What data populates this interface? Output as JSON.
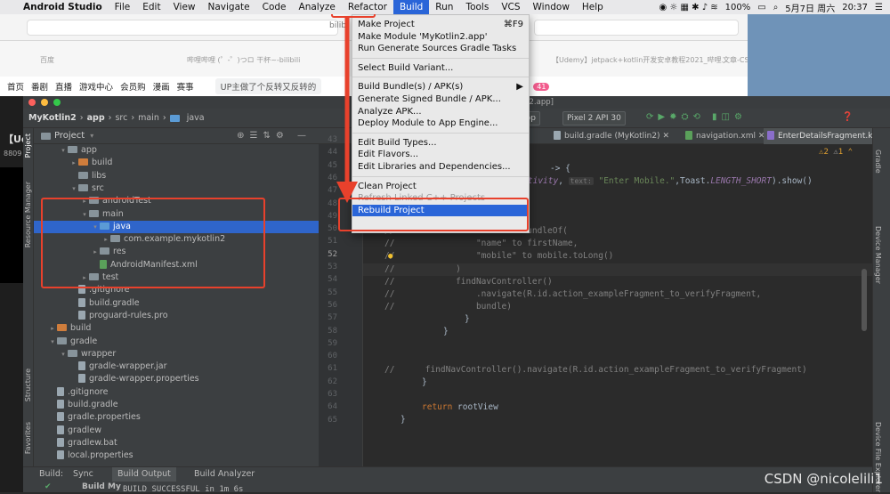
{
  "menubar": {
    "app": "Android Studio",
    "items": [
      "File",
      "Edit",
      "View",
      "Navigate",
      "Code",
      "Analyze",
      "Refactor",
      "Build",
      "Run",
      "Tools",
      "VCS",
      "Window",
      "Help"
    ],
    "battery": "100%",
    "date": "5月7日 周六",
    "time": "20:37"
  },
  "browser": {
    "tab1": "百度",
    "tab2": "哔哩哔哩 (゜-゜)つロ 干杯~-bilibili",
    "addr_frag": "bilib",
    "tab3": "【Udemy】jetpack+kotlin开发安卓教程2021_哔哩...",
    "tab4": "文章-CSDN创作中心",
    "nav": [
      "首页",
      "番剧",
      "直播",
      "游戏中心",
      "会员购",
      "漫画",
      "赛事"
    ],
    "notice": "UP主做了个反转又反转的",
    "badge": "41",
    "left_frag1": "【Ud",
    "left_frag2": "8809"
  },
  "ide": {
    "window_title": "…2.app]",
    "project": "MyKotlin2",
    "breadcrumb": [
      "app",
      "src",
      "main",
      "java"
    ],
    "device": "Pixel 2 API 30",
    "run_config": "app"
  },
  "project_pane": {
    "title": "Project",
    "rows": [
      {
        "label": "app",
        "indent": 2,
        "arrow": "▾",
        "kind": "folder-gray"
      },
      {
        "label": "build",
        "indent": 3,
        "arrow": "▸",
        "kind": "folder-orange"
      },
      {
        "label": "libs",
        "indent": 3,
        "arrow": "",
        "kind": "folder-gray"
      },
      {
        "label": "src",
        "indent": 3,
        "arrow": "▾",
        "kind": "folder-gray"
      },
      {
        "label": "androidTest",
        "indent": 4,
        "arrow": "▸",
        "kind": "folder-gray"
      },
      {
        "label": "main",
        "indent": 4,
        "arrow": "▾",
        "kind": "folder-gray"
      },
      {
        "label": "java",
        "indent": 5,
        "arrow": "▾",
        "kind": "folder-blue",
        "sel": true
      },
      {
        "label": "com.example.mykotlin2",
        "indent": 6,
        "arrow": "▸",
        "kind": "folder-gray"
      },
      {
        "label": "res",
        "indent": 5,
        "arrow": "▸",
        "kind": "folder-gray"
      },
      {
        "label": "AndroidManifest.xml",
        "indent": 5,
        "arrow": "",
        "kind": "file-xml"
      },
      {
        "label": "test",
        "indent": 4,
        "arrow": "▸",
        "kind": "folder-gray"
      },
      {
        "label": ".gitignore",
        "indent": 3,
        "arrow": "",
        "kind": "file"
      },
      {
        "label": "build.gradle",
        "indent": 3,
        "arrow": "",
        "kind": "file"
      },
      {
        "label": "proguard-rules.pro",
        "indent": 3,
        "arrow": "",
        "kind": "file"
      },
      {
        "label": "build",
        "indent": 1,
        "arrow": "▸",
        "kind": "folder-orange"
      },
      {
        "label": "gradle",
        "indent": 1,
        "arrow": "▾",
        "kind": "folder-gray"
      },
      {
        "label": "wrapper",
        "indent": 2,
        "arrow": "▾",
        "kind": "folder-gray"
      },
      {
        "label": "gradle-wrapper.jar",
        "indent": 3,
        "arrow": "",
        "kind": "file"
      },
      {
        "label": "gradle-wrapper.properties",
        "indent": 3,
        "arrow": "",
        "kind": "file"
      },
      {
        "label": ".gitignore",
        "indent": 1,
        "arrow": "",
        "kind": "file"
      },
      {
        "label": "build.gradle",
        "indent": 1,
        "arrow": "",
        "kind": "file"
      },
      {
        "label": "gradle.properties",
        "indent": 1,
        "arrow": "",
        "kind": "file"
      },
      {
        "label": "gradlew",
        "indent": 1,
        "arrow": "",
        "kind": "file"
      },
      {
        "label": "gradlew.bat",
        "indent": 1,
        "arrow": "",
        "kind": "file"
      },
      {
        "label": "local.properties",
        "indent": 1,
        "arrow": "",
        "kind": "file"
      }
    ]
  },
  "editor_tabs": [
    "build.gradle (MyKotlin2)",
    "navigation.xml",
    "EnterDetailsFragment.kt"
  ],
  "inspections": {
    "warnings": "2",
    "weak": "1"
  },
  "line_numbers": [
    "43",
    "44",
    "45",
    "46",
    "47",
    "48",
    "49",
    "50",
    "51",
    "52",
    "53",
    "54",
    "55",
    "56",
    "57",
    "58",
    "59",
    "60",
    "61",
    "62",
    "63",
    "64",
    "65"
  ],
  "code": {
    "l44a": "-> {",
    "l45a": "t(",
    "l45b": "activity",
    "l45c": ", ",
    "l45d": "text:",
    "l45e": " \"Enter Mobile.\"",
    "l45f": ",Toast.",
    "l45g": "LENGTH_SHORT",
    "l45h": ").show()",
    "l48a": "else",
    "l48b": " -> {",
    "l49": "//            val bundle = bundleOf(",
    "l50": "//                \"name\" to firstName,",
    "l51": "//                \"mobile\" to mobile.toLong()",
    "l52": "//            )",
    "l53": "//            findNavController()",
    "l54": "//                .navigate(R.id.action_exampleFragment_to_verifyFragment,",
    "l55": "//                bundle)",
    "l56": "}",
    "l57": "}",
    "l60": "//      findNavController().navigate(R.id.action_exampleFragment_to_verifyFragment)",
    "l61": "}",
    "l63a": "return",
    "l63b": " rootView",
    "l64": "}"
  },
  "build_menu": {
    "items": [
      {
        "label": "Make Project",
        "shortcut": "⌘F9"
      },
      {
        "label": "Make Module 'MyKotlin2.app'"
      },
      {
        "label": "Run Generate Sources Gradle Tasks"
      },
      {
        "sep": true
      },
      {
        "label": "Select Build Variant..."
      },
      {
        "sep": true
      },
      {
        "label": "Build Bundle(s) / APK(s)",
        "submenu": "▶"
      },
      {
        "label": "Generate Signed Bundle / APK..."
      },
      {
        "label": "Analyze APK..."
      },
      {
        "label": "Deploy Module to App Engine..."
      },
      {
        "sep": true
      },
      {
        "label": "Edit Build Types..."
      },
      {
        "label": "Edit Flavors..."
      },
      {
        "label": "Edit Libraries and Dependencies..."
      },
      {
        "sep": true
      },
      {
        "label": "Clean Project"
      },
      {
        "label": "Refresh Linked C++ Projects",
        "disabled": true
      },
      {
        "label": "Rebuild Project",
        "highlight": true
      }
    ]
  },
  "bottom": {
    "label": "Build:",
    "tabs": [
      "Sync",
      "Build Output",
      "Build Analyzer"
    ],
    "tree": "Build My",
    "status": "BUILD SUCCESSFUL in 1m 6s"
  },
  "side_tools": {
    "left": [
      "Project",
      "Resource Manager",
      "Structure",
      "Favorites"
    ],
    "right": [
      "Gradle",
      "Device Manager",
      "Device File Explorer"
    ]
  },
  "watermark": "CSDN @nicolelili1"
}
